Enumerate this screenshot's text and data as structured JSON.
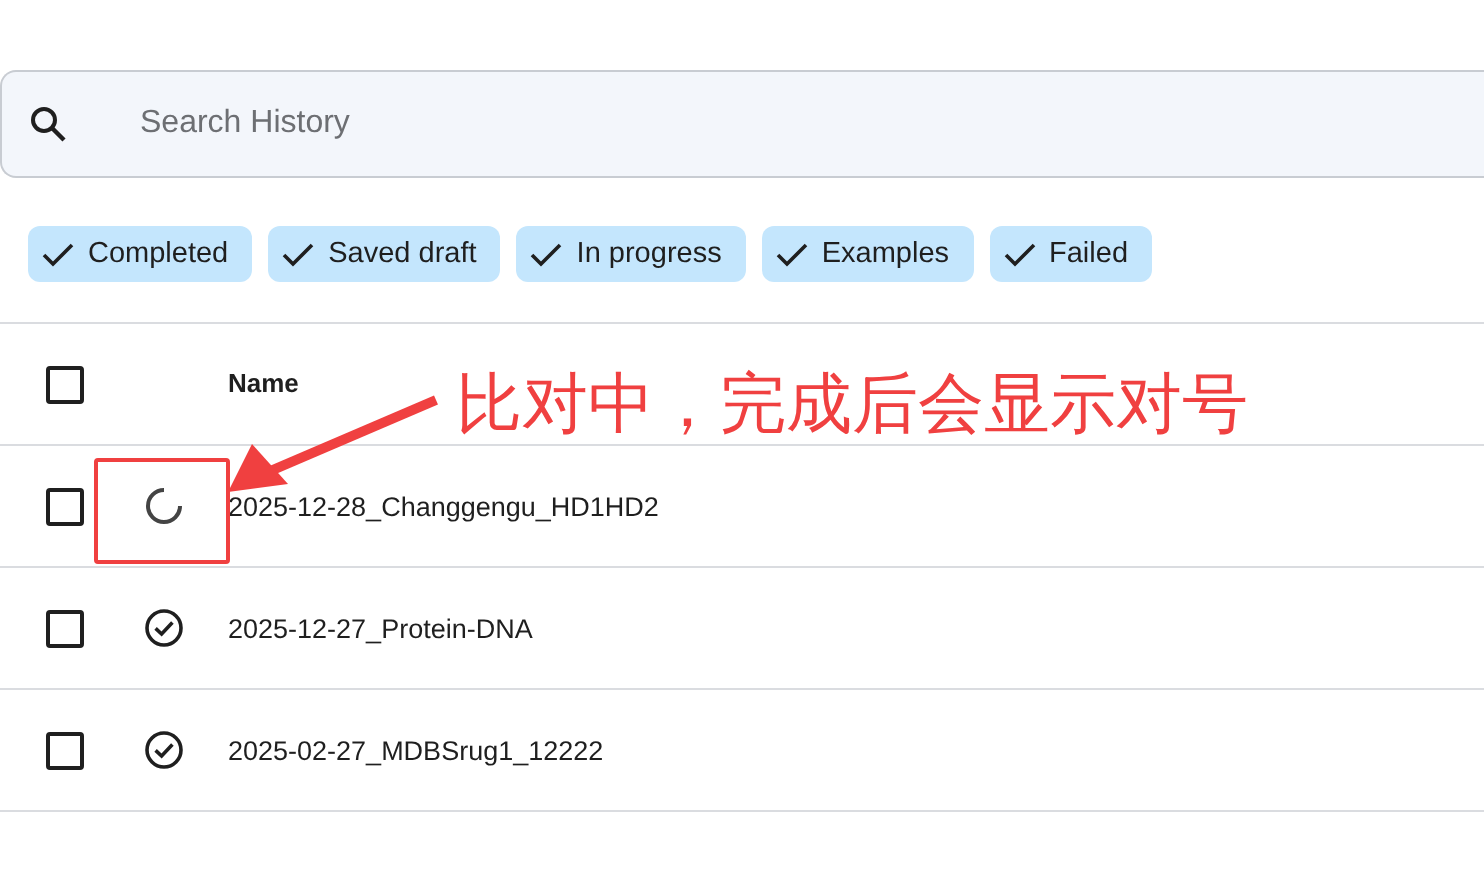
{
  "search": {
    "placeholder": "Search History"
  },
  "filters": [
    {
      "label": "Completed",
      "selected": true
    },
    {
      "label": "Saved draft",
      "selected": true
    },
    {
      "label": "In progress",
      "selected": true
    },
    {
      "label": "Examples",
      "selected": true
    },
    {
      "label": "Failed",
      "selected": true
    }
  ],
  "table": {
    "header": {
      "checked": false,
      "name": "Name"
    },
    "rows": [
      {
        "checked": false,
        "kind": "running",
        "name": "2025-12-28_Changgengu_HD1HD2"
      },
      {
        "checked": false,
        "kind": "done",
        "name": "2025-12-27_Protein-DNA"
      },
      {
        "checked": false,
        "kind": "done",
        "name": "2025-02-27_MDBSrug1_12222"
      }
    ]
  },
  "annotation": {
    "text": "比对中，完成后会显示对号"
  }
}
